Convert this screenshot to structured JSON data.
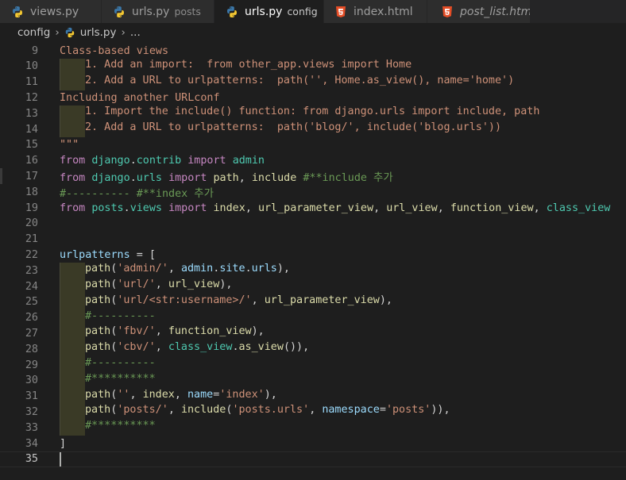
{
  "tabs": [
    {
      "name": "views.py",
      "desc": "",
      "type": "py",
      "active": false,
      "italic": false
    },
    {
      "name": "urls.py",
      "desc": "posts",
      "type": "py",
      "active": false,
      "italic": false
    },
    {
      "name": "urls.py",
      "desc": "config",
      "type": "py",
      "active": true,
      "italic": false
    },
    {
      "name": "index.html",
      "desc": "",
      "type": "html",
      "active": false,
      "italic": false
    },
    {
      "name": "post_list.html",
      "desc": "",
      "type": "html",
      "active": false,
      "italic": true
    }
  ],
  "breadcrumb": {
    "folder": "config",
    "file": "urls.py",
    "tail": "..."
  },
  "colors": {
    "string": "#ce9178",
    "keyword": "#c586c0",
    "module": "#4ec9b0",
    "variable": "#9cdcfe",
    "function": "#dcdcaa",
    "comment": "#6a9955"
  },
  "lines": [
    {
      "n": "9",
      "indent": 0,
      "tokens": [
        [
          "str",
          "Class-based views"
        ]
      ]
    },
    {
      "n": "10",
      "indent": 1,
      "tokens": [
        [
          "str",
          "1. Add an import:  from other_app.views import Home"
        ]
      ]
    },
    {
      "n": "11",
      "indent": 1,
      "tokens": [
        [
          "str",
          "2. Add a URL to urlpatterns:  path('', Home.as_view(), name='home')"
        ]
      ]
    },
    {
      "n": "12",
      "indent": 0,
      "tokens": [
        [
          "str",
          "Including another URLconf"
        ]
      ]
    },
    {
      "n": "13",
      "indent": 1,
      "tokens": [
        [
          "str",
          "1. Import the include() function: from django.urls import include, path"
        ]
      ]
    },
    {
      "n": "14",
      "indent": 1,
      "tokens": [
        [
          "str",
          "2. Add a URL to urlpatterns:  path('blog/', include('blog.urls'))"
        ]
      ]
    },
    {
      "n": "15",
      "indent": 0,
      "tokens": [
        [
          "str",
          "\"\"\""
        ]
      ]
    },
    {
      "n": "16",
      "indent": 0,
      "tokens": [
        [
          "kw",
          "from"
        ],
        [
          "pl",
          " "
        ],
        [
          "mod",
          "django"
        ],
        [
          "pl",
          "."
        ],
        [
          "mod",
          "contrib"
        ],
        [
          "pl",
          " "
        ],
        [
          "kw",
          "import"
        ],
        [
          "pl",
          " "
        ],
        [
          "mod",
          "admin"
        ]
      ]
    },
    {
      "n": "17",
      "indent": 0,
      "tokens": [
        [
          "kw",
          "from"
        ],
        [
          "pl",
          " "
        ],
        [
          "mod",
          "django"
        ],
        [
          "pl",
          "."
        ],
        [
          "mod",
          "urls"
        ],
        [
          "pl",
          " "
        ],
        [
          "kw",
          "import"
        ],
        [
          "pl",
          " "
        ],
        [
          "fn",
          "path"
        ],
        [
          "pl",
          ", "
        ],
        [
          "fn",
          "include"
        ],
        [
          "pl",
          " "
        ],
        [
          "cmt",
          "#**include 추가"
        ]
      ]
    },
    {
      "n": "18",
      "indent": 0,
      "tokens": [
        [
          "cmt",
          "#---------- #**index 추가"
        ]
      ]
    },
    {
      "n": "19",
      "indent": 0,
      "tokens": [
        [
          "kw",
          "from"
        ],
        [
          "pl",
          " "
        ],
        [
          "mod",
          "posts"
        ],
        [
          "pl",
          "."
        ],
        [
          "mod",
          "views"
        ],
        [
          "pl",
          " "
        ],
        [
          "kw",
          "import"
        ],
        [
          "pl",
          " "
        ],
        [
          "fn",
          "index"
        ],
        [
          "pl",
          ", "
        ],
        [
          "fn",
          "url_parameter_view"
        ],
        [
          "pl",
          ", "
        ],
        [
          "fn",
          "url_view"
        ],
        [
          "pl",
          ", "
        ],
        [
          "fn",
          "function_view"
        ],
        [
          "pl",
          ", "
        ],
        [
          "cls",
          "class_view"
        ]
      ]
    },
    {
      "n": "20",
      "indent": 0,
      "tokens": []
    },
    {
      "n": "21",
      "indent": 0,
      "tokens": []
    },
    {
      "n": "22",
      "indent": 0,
      "tokens": [
        [
          "var",
          "urlpatterns"
        ],
        [
          "pl",
          " = ["
        ]
      ]
    },
    {
      "n": "23",
      "indent": 1,
      "tokens": [
        [
          "fn",
          "path"
        ],
        [
          "pl",
          "("
        ],
        [
          "str",
          "'admin/'"
        ],
        [
          "pl",
          ", "
        ],
        [
          "var",
          "admin"
        ],
        [
          "pl",
          "."
        ],
        [
          "var",
          "site"
        ],
        [
          "pl",
          "."
        ],
        [
          "var",
          "urls"
        ],
        [
          "pl",
          "),"
        ]
      ]
    },
    {
      "n": "24",
      "indent": 1,
      "tokens": [
        [
          "fn",
          "path"
        ],
        [
          "pl",
          "("
        ],
        [
          "str",
          "'url/'"
        ],
        [
          "pl",
          ", "
        ],
        [
          "fn",
          "url_view"
        ],
        [
          "pl",
          "),"
        ]
      ]
    },
    {
      "n": "25",
      "indent": 1,
      "tokens": [
        [
          "fn",
          "path"
        ],
        [
          "pl",
          "("
        ],
        [
          "str",
          "'url/<str:username>/'"
        ],
        [
          "pl",
          ", "
        ],
        [
          "fn",
          "url_parameter_view"
        ],
        [
          "pl",
          "),"
        ]
      ]
    },
    {
      "n": "26",
      "indent": 1,
      "tokens": [
        [
          "cmt",
          "#----------"
        ]
      ]
    },
    {
      "n": "27",
      "indent": 1,
      "tokens": [
        [
          "fn",
          "path"
        ],
        [
          "pl",
          "("
        ],
        [
          "str",
          "'fbv/'"
        ],
        [
          "pl",
          ", "
        ],
        [
          "fn",
          "function_view"
        ],
        [
          "pl",
          "),"
        ]
      ]
    },
    {
      "n": "28",
      "indent": 1,
      "tokens": [
        [
          "fn",
          "path"
        ],
        [
          "pl",
          "("
        ],
        [
          "str",
          "'cbv/'"
        ],
        [
          "pl",
          ", "
        ],
        [
          "cls",
          "class_view"
        ],
        [
          "pl",
          "."
        ],
        [
          "fn",
          "as_view"
        ],
        [
          "pl",
          "()),"
        ]
      ]
    },
    {
      "n": "29",
      "indent": 1,
      "tokens": [
        [
          "cmt",
          "#----------"
        ]
      ]
    },
    {
      "n": "30",
      "indent": 1,
      "tokens": [
        [
          "cmt",
          "#**********"
        ]
      ]
    },
    {
      "n": "31",
      "indent": 1,
      "tokens": [
        [
          "fn",
          "path"
        ],
        [
          "pl",
          "("
        ],
        [
          "str",
          "''"
        ],
        [
          "pl",
          ", "
        ],
        [
          "fn",
          "index"
        ],
        [
          "pl",
          ", "
        ],
        [
          "var",
          "name"
        ],
        [
          "pl",
          "="
        ],
        [
          "str",
          "'index'"
        ],
        [
          "pl",
          "),"
        ]
      ]
    },
    {
      "n": "32",
      "indent": 1,
      "tokens": [
        [
          "fn",
          "path"
        ],
        [
          "pl",
          "("
        ],
        [
          "str",
          "'posts/'"
        ],
        [
          "pl",
          ", "
        ],
        [
          "fn",
          "include"
        ],
        [
          "pl",
          "("
        ],
        [
          "str",
          "'posts.urls'"
        ],
        [
          "pl",
          ", "
        ],
        [
          "var",
          "namespace"
        ],
        [
          "pl",
          "="
        ],
        [
          "str",
          "'posts'"
        ],
        [
          "pl",
          ")),"
        ]
      ]
    },
    {
      "n": "33",
      "indent": 1,
      "tokens": [
        [
          "cmt",
          "#**********"
        ]
      ]
    },
    {
      "n": "34",
      "indent": 0,
      "tokens": [
        [
          "pl",
          "]"
        ]
      ]
    },
    {
      "n": "35",
      "indent": 0,
      "tokens": [],
      "current": true
    }
  ]
}
